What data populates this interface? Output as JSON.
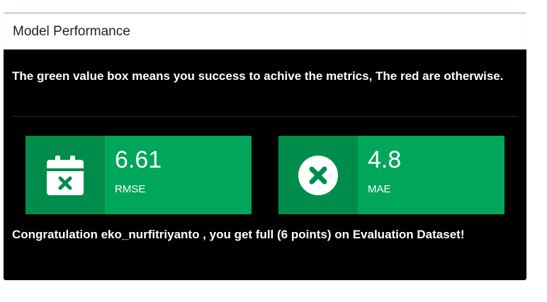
{
  "panel": {
    "title": "Model Performance"
  },
  "intro_text": "The green value box means you success to achive the metrics, The red are otherwise.",
  "metrics": [
    {
      "value": "6.61",
      "label": "RMSE",
      "icon": "calendar-x-icon",
      "status_color": "#00a65a"
    },
    {
      "value": "4.8",
      "label": "MAE",
      "icon": "circle-x-icon",
      "status_color": "#00a65a"
    }
  ],
  "congrats_text": "Congratulation eko_nurfitriyanto , you get full (6 points) on Evaluation Dataset!"
}
